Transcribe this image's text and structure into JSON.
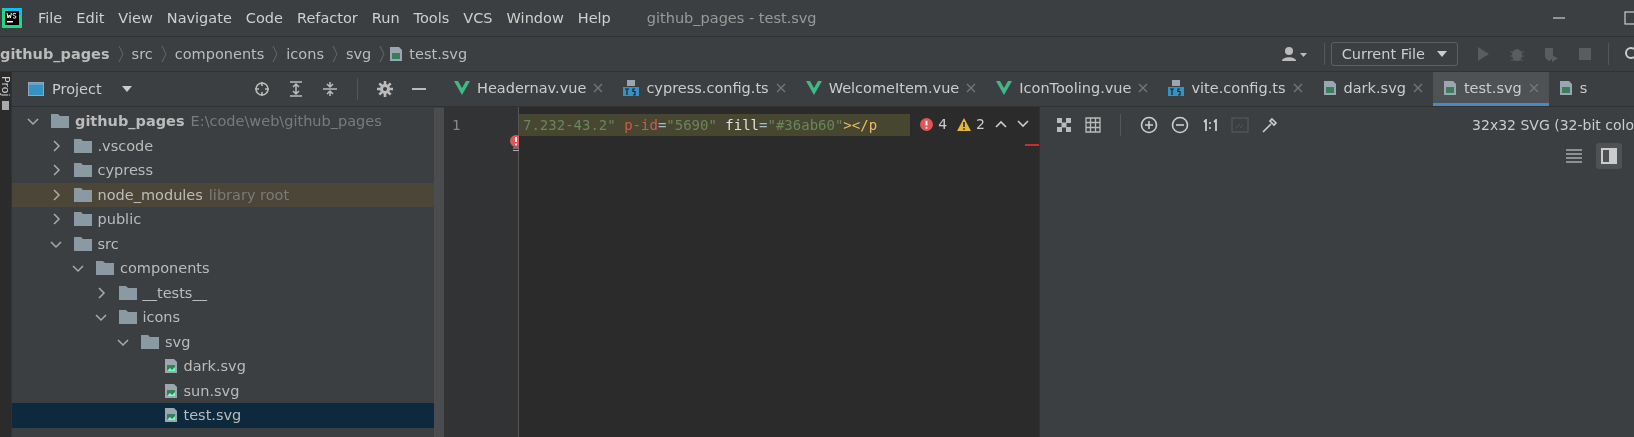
{
  "menu": [
    "File",
    "Edit",
    "View",
    "Navigate",
    "Code",
    "Refactor",
    "Run",
    "Tools",
    "VCS",
    "Window",
    "Help"
  ],
  "window": {
    "title": "github_pages - test.svg"
  },
  "breadcrumbs": [
    {
      "label": "github_pages",
      "kind": "project"
    },
    {
      "label": "src",
      "kind": "dir"
    },
    {
      "label": "components",
      "kind": "dir"
    },
    {
      "label": "icons",
      "kind": "dir"
    },
    {
      "label": "svg",
      "kind": "dir"
    },
    {
      "label": "test.svg",
      "kind": "file"
    }
  ],
  "run_config": "Current File",
  "side_strip": "Proj",
  "project_panel": {
    "title": "Project"
  },
  "tree": [
    {
      "label": "github_pages",
      "hint": "E:\\code\\web\\github_pages",
      "kind": "root",
      "expanded": true,
      "selected": false,
      "children": [
        {
          "label": ".vscode",
          "kind": "folder",
          "expanded": false,
          "selected": false
        },
        {
          "label": "cypress",
          "kind": "folder",
          "expanded": false,
          "selected": false
        },
        {
          "label": "node_modules",
          "hint": "library root",
          "kind": "library",
          "expanded": false,
          "selected": false
        },
        {
          "label": "public",
          "kind": "folder",
          "expanded": false,
          "selected": false
        },
        {
          "label": "src",
          "kind": "folder",
          "expanded": true,
          "selected": false,
          "children": [
            {
              "label": "components",
              "kind": "folder",
              "expanded": true,
              "selected": false,
              "children": [
                {
                  "label": "__tests__",
                  "kind": "folder",
                  "expanded": false,
                  "selected": false
                },
                {
                  "label": "icons",
                  "kind": "folder",
                  "expanded": true,
                  "selected": false,
                  "children": [
                    {
                      "label": "svg",
                      "kind": "folder",
                      "expanded": true,
                      "selected": false,
                      "children": [
                        {
                          "label": "dark.svg",
                          "kind": "file",
                          "selected": false
                        },
                        {
                          "label": "sun.svg",
                          "kind": "file",
                          "selected": false
                        },
                        {
                          "label": "test.svg",
                          "kind": "file",
                          "selected": true
                        }
                      ]
                    }
                  ]
                }
              ]
            }
          ]
        }
      ]
    }
  ],
  "tabs": [
    {
      "label": "Headernav.vue",
      "kind": "vue",
      "selected": false,
      "closable": true
    },
    {
      "label": "cypress.config.ts",
      "kind": "ts",
      "selected": false,
      "closable": true
    },
    {
      "label": "WelcomeItem.vue",
      "kind": "vue",
      "selected": false,
      "closable": true
    },
    {
      "label": "IconTooling.vue",
      "kind": "vue",
      "selected": false,
      "closable": true
    },
    {
      "label": "vite.config.ts",
      "kind": "ts",
      "selected": false,
      "closable": true
    },
    {
      "label": "dark.svg",
      "kind": "svg",
      "selected": false,
      "closable": true
    },
    {
      "label": "test.svg",
      "kind": "svg",
      "selected": true,
      "closable": true
    },
    {
      "label": "s",
      "kind": "svg",
      "selected": false,
      "closable": false
    }
  ],
  "editor": {
    "line_number": "1",
    "code": [
      {
        "text": "7.232-43.2\" ",
        "kind": "value"
      },
      {
        "text": "p-id",
        "kind": "bad-attr"
      },
      {
        "text": "=",
        "kind": "plain"
      },
      {
        "text": "\"5690\" ",
        "kind": "value"
      },
      {
        "text": "fill",
        "kind": "attr"
      },
      {
        "text": "=",
        "kind": "plain"
      },
      {
        "text": "\"#36ab60\"",
        "kind": "value"
      },
      {
        "text": "></p",
        "kind": "tag"
      }
    ],
    "errors": "4",
    "warnings": "2"
  },
  "viewer": {
    "info": "32x32 SVG (32-bit colo"
  }
}
